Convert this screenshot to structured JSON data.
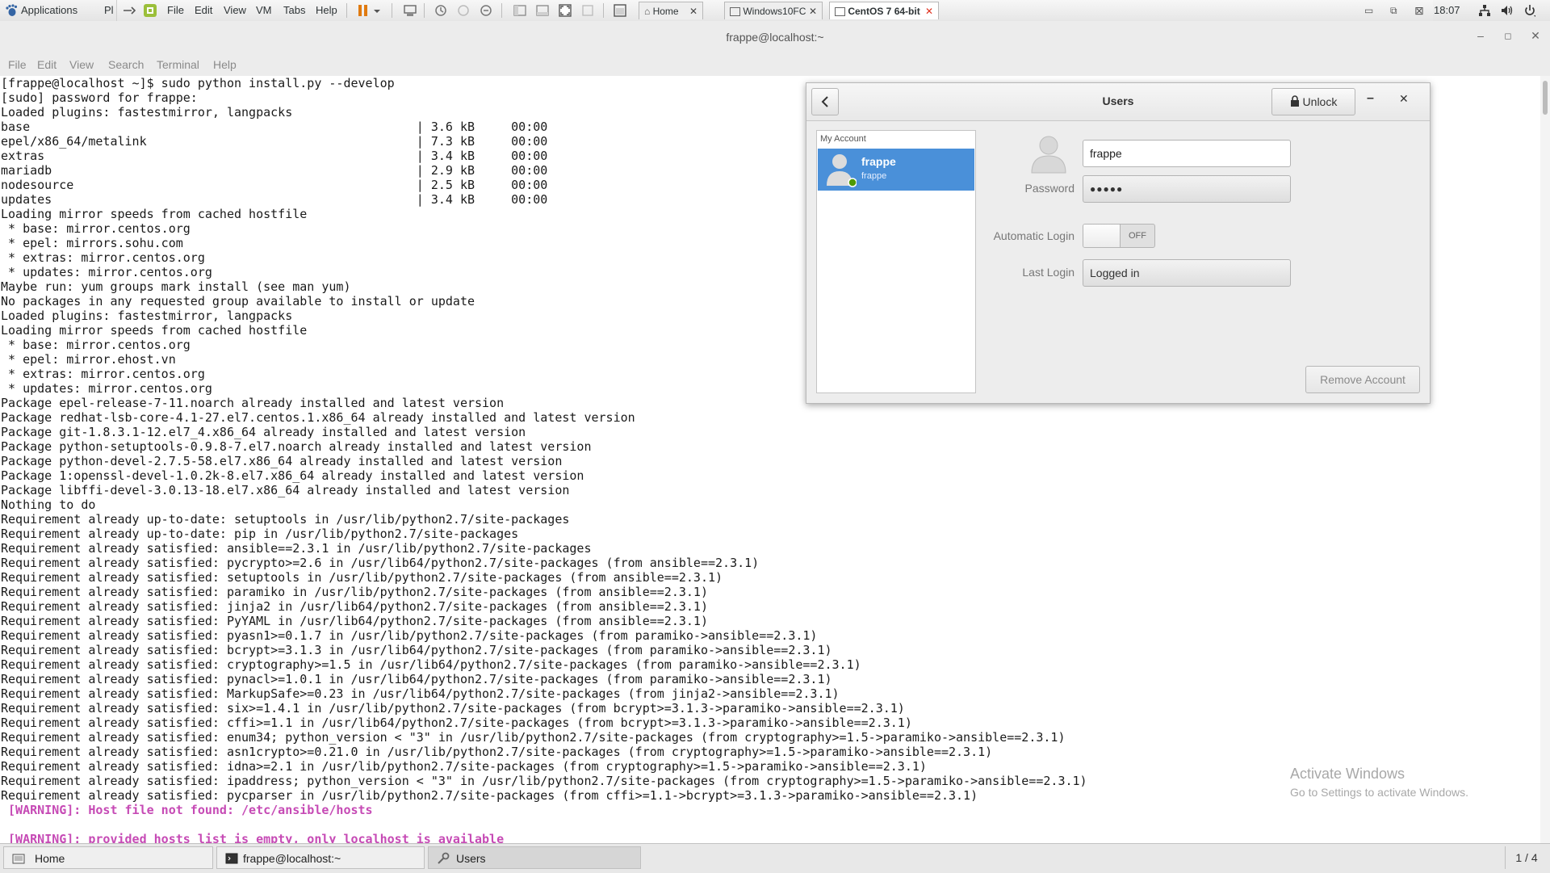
{
  "topbar": {
    "applications": "Applications",
    "places": "Pl",
    "vmware_menu": [
      "File",
      "Edit",
      "View",
      "VM",
      "Tabs",
      "Help"
    ],
    "tabs": [
      {
        "label": "Home",
        "icon": "home-icon"
      },
      {
        "label": "Windows10FC",
        "icon": "vm-icon"
      },
      {
        "label": "CentOS 7 64-bit",
        "icon": "vm-icon"
      }
    ],
    "clock": "18:07",
    "status_icons": [
      "network-icon",
      "volume-icon",
      "power-icon"
    ]
  },
  "terminal_window": {
    "title": "frappe@localhost:~",
    "menu": [
      "File",
      "Edit",
      "View",
      "Search",
      "Terminal",
      "Help"
    ]
  },
  "terminal": {
    "lines": [
      {
        "text": "[frappe@localhost ~]$ sudo python install.py --develop"
      },
      {
        "text": "[sudo] password for frappe:"
      },
      {
        "text": "Loaded plugins: fastestmirror, langpacks"
      },
      {
        "text": "base                                                     | 3.6 kB     00:00"
      },
      {
        "text": "epel/x86_64/metalink                                     | 7.3 kB     00:00"
      },
      {
        "text": "extras                                                   | 3.4 kB     00:00"
      },
      {
        "text": "mariadb                                                  | 2.9 kB     00:00"
      },
      {
        "text": "nodesource                                               | 2.5 kB     00:00"
      },
      {
        "text": "updates                                                  | 3.4 kB     00:00"
      },
      {
        "text": "Loading mirror speeds from cached hostfile"
      },
      {
        "text": " * base: mirror.centos.org"
      },
      {
        "text": " * epel: mirrors.sohu.com"
      },
      {
        "text": " * extras: mirror.centos.org"
      },
      {
        "text": " * updates: mirror.centos.org"
      },
      {
        "text": "Maybe run: yum groups mark install (see man yum)"
      },
      {
        "text": "No packages in any requested group available to install or update"
      },
      {
        "text": "Loaded plugins: fastestmirror, langpacks"
      },
      {
        "text": "Loading mirror speeds from cached hostfile"
      },
      {
        "text": " * base: mirror.centos.org"
      },
      {
        "text": " * epel: mirror.ehost.vn"
      },
      {
        "text": " * extras: mirror.centos.org"
      },
      {
        "text": " * updates: mirror.centos.org"
      },
      {
        "text": "Package epel-release-7-11.noarch already installed and latest version"
      },
      {
        "text": "Package redhat-lsb-core-4.1-27.el7.centos.1.x86_64 already installed and latest version"
      },
      {
        "text": "Package git-1.8.3.1-12.el7_4.x86_64 already installed and latest version"
      },
      {
        "text": "Package python-setuptools-0.9.8-7.el7.noarch already installed and latest version"
      },
      {
        "text": "Package python-devel-2.7.5-58.el7.x86_64 already installed and latest version"
      },
      {
        "text": "Package 1:openssl-devel-1.0.2k-8.el7.x86_64 already installed and latest version"
      },
      {
        "text": "Package libffi-devel-3.0.13-18.el7.x86_64 already installed and latest version"
      },
      {
        "text": "Nothing to do"
      },
      {
        "text": "Requirement already up-to-date: setuptools in /usr/lib/python2.7/site-packages"
      },
      {
        "text": "Requirement already up-to-date: pip in /usr/lib/python2.7/site-packages"
      },
      {
        "text": "Requirement already satisfied: ansible==2.3.1 in /usr/lib/python2.7/site-packages"
      },
      {
        "text": "Requirement already satisfied: pycrypto>=2.6 in /usr/lib64/python2.7/site-packages (from ansible==2.3.1)"
      },
      {
        "text": "Requirement already satisfied: setuptools in /usr/lib/python2.7/site-packages (from ansible==2.3.1)"
      },
      {
        "text": "Requirement already satisfied: paramiko in /usr/lib/python2.7/site-packages (from ansible==2.3.1)"
      },
      {
        "text": "Requirement already satisfied: jinja2 in /usr/lib64/python2.7/site-packages (from ansible==2.3.1)"
      },
      {
        "text": "Requirement already satisfied: PyYAML in /usr/lib64/python2.7/site-packages (from ansible==2.3.1)"
      },
      {
        "text": "Requirement already satisfied: pyasn1>=0.1.7 in /usr/lib/python2.7/site-packages (from paramiko->ansible==2.3.1)"
      },
      {
        "text": "Requirement already satisfied: bcrypt>=3.1.3 in /usr/lib64/python2.7/site-packages (from paramiko->ansible==2.3.1)"
      },
      {
        "text": "Requirement already satisfied: cryptography>=1.5 in /usr/lib64/python2.7/site-packages (from paramiko->ansible==2.3.1)"
      },
      {
        "text": "Requirement already satisfied: pynacl>=1.0.1 in /usr/lib64/python2.7/site-packages (from paramiko->ansible==2.3.1)"
      },
      {
        "text": "Requirement already satisfied: MarkupSafe>=0.23 in /usr/lib64/python2.7/site-packages (from jinja2->ansible==2.3.1)"
      },
      {
        "text": "Requirement already satisfied: six>=1.4.1 in /usr/lib/python2.7/site-packages (from bcrypt>=3.1.3->paramiko->ansible==2.3.1)"
      },
      {
        "text": "Requirement already satisfied: cffi>=1.1 in /usr/lib64/python2.7/site-packages (from bcrypt>=3.1.3->paramiko->ansible==2.3.1)"
      },
      {
        "text": "Requirement already satisfied: enum34; python_version < \"3\" in /usr/lib/python2.7/site-packages (from cryptography>=1.5->paramiko->ansible==2.3.1)"
      },
      {
        "text": "Requirement already satisfied: asn1crypto>=0.21.0 in /usr/lib/python2.7/site-packages (from cryptography>=1.5->paramiko->ansible==2.3.1)"
      },
      {
        "text": "Requirement already satisfied: idna>=2.1 in /usr/lib/python2.7/site-packages (from cryptography>=1.5->paramiko->ansible==2.3.1)"
      },
      {
        "text": "Requirement already satisfied: ipaddress; python_version < \"3\" in /usr/lib/python2.7/site-packages (from cryptography>=1.5->paramiko->ansible==2.3.1)"
      },
      {
        "text": "Requirement already satisfied: pycparser in /usr/lib/python2.7/site-packages (from cffi>=1.1->bcrypt>=3.1.3->paramiko->ansible==2.3.1)"
      },
      {
        "text": " [WARNING]: Host file not found: /etc/ansible/hosts",
        "warning": true
      },
      {
        "text": ""
      },
      {
        "text": " [WARNING]: provided hosts list is empty, only localhost is available",
        "warning": true
      }
    ],
    "warning_color": "#c64ab5",
    "watermark": {
      "title": "Activate Windows",
      "subtitle": "Go to Settings to activate Windows."
    }
  },
  "users_dialog": {
    "title": "Users",
    "back_icon": "chevron-left-icon",
    "unlock_label": "Unlock",
    "unlock_icon": "lock-icon",
    "list_heading": "My Account",
    "account": {
      "name": "frappe",
      "username": "frappe",
      "status_color": "#4e9a06"
    },
    "name_value": "frappe",
    "password_label": "Password",
    "password_value": "●●●●●",
    "autologin_label": "Automatic Login",
    "autologin_state": "OFF",
    "lastlogin_label": "Last Login",
    "lastlogin_value": "Logged in",
    "remove_label": "Remove Account",
    "accent": "#4a90d9"
  },
  "taskbar": {
    "items": [
      {
        "label": "Home",
        "icon": "folder-icon"
      },
      {
        "label": "frappe@localhost:~",
        "icon": "terminal-icon"
      },
      {
        "label": "Users",
        "icon": "users-settings-icon"
      }
    ],
    "workspace": "1 / 4"
  }
}
